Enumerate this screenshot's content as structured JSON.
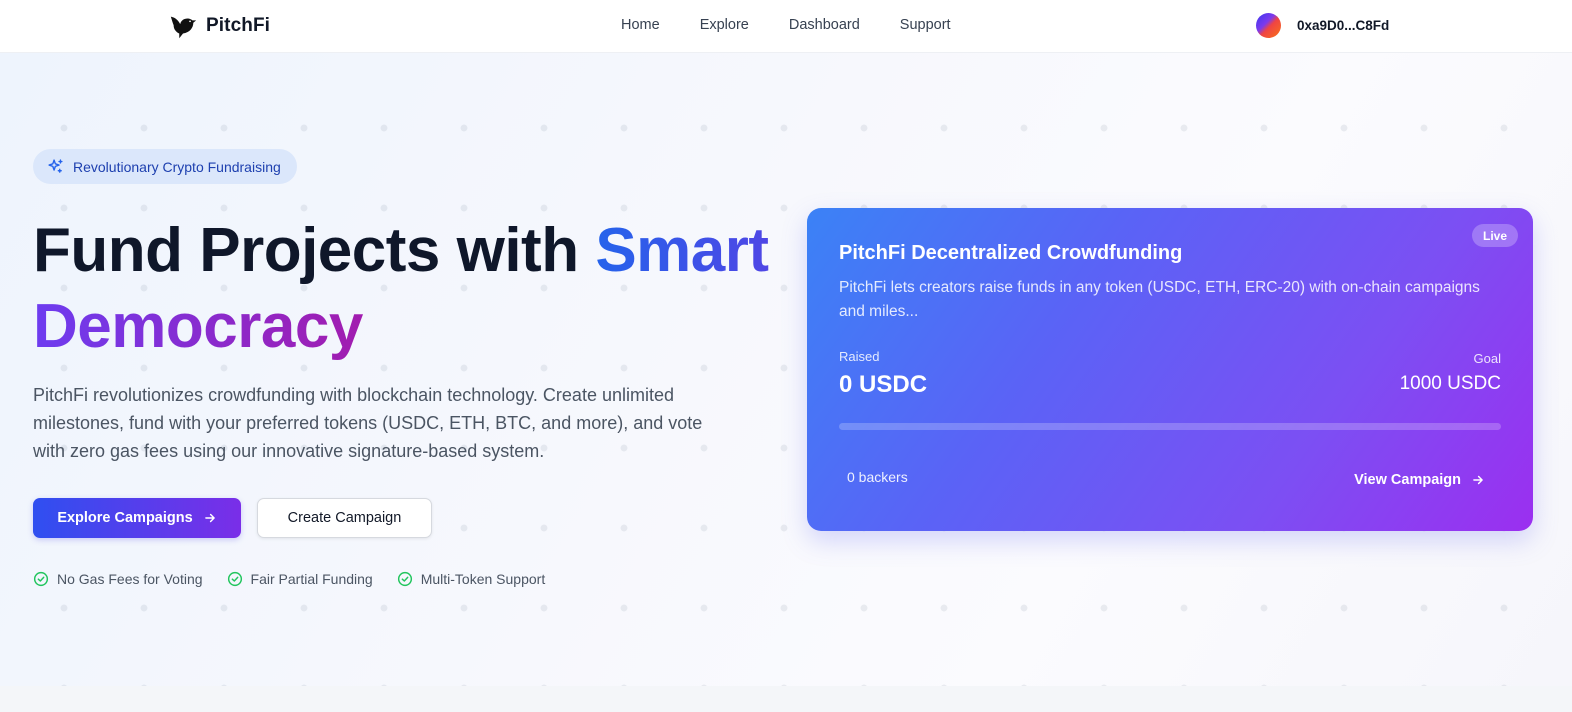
{
  "nav": {
    "brand": "PitchFi",
    "links": [
      "Home",
      "Explore",
      "Dashboard",
      "Support"
    ],
    "wallet_address": "0xa9D0...C8Fd"
  },
  "hero": {
    "badge": "Revolutionary Crypto Fundraising",
    "headline_part1": "Fund Projects with ",
    "headline_highlight1": "Smart",
    "headline_highlight2": "Democracy",
    "description": "PitchFi revolutionizes crowdfunding with blockchain technology. Create unlimited milestones, fund with your preferred tokens (USDC, ETH, BTC, and more), and vote with zero gas fees using our innovative signature-based system.",
    "primary_button": "Explore Campaigns",
    "secondary_button": "Create Campaign",
    "features": [
      "No Gas Fees for Voting",
      "Fair Partial Funding",
      "Multi-Token Support"
    ]
  },
  "campaign_card": {
    "status": "Live",
    "title": "PitchFi Decentralized Crowdfunding",
    "description": "PitchFi lets creators raise funds in any token (USDC, ETH, ERC-20) with on-chain campaigns and miles...",
    "raised_label": "Raised",
    "raised_value": "0 USDC",
    "goal_label": "Goal",
    "goal_value": "1000 USDC",
    "progress_fraction": 0,
    "backers": "0 backers",
    "view_button": "View Campaign"
  },
  "colors": {
    "accent_blue": "#2563eb",
    "accent_purple": "#7c3aed",
    "check_green": "#22c55e",
    "badge_bg": "#dbe7fb"
  }
}
